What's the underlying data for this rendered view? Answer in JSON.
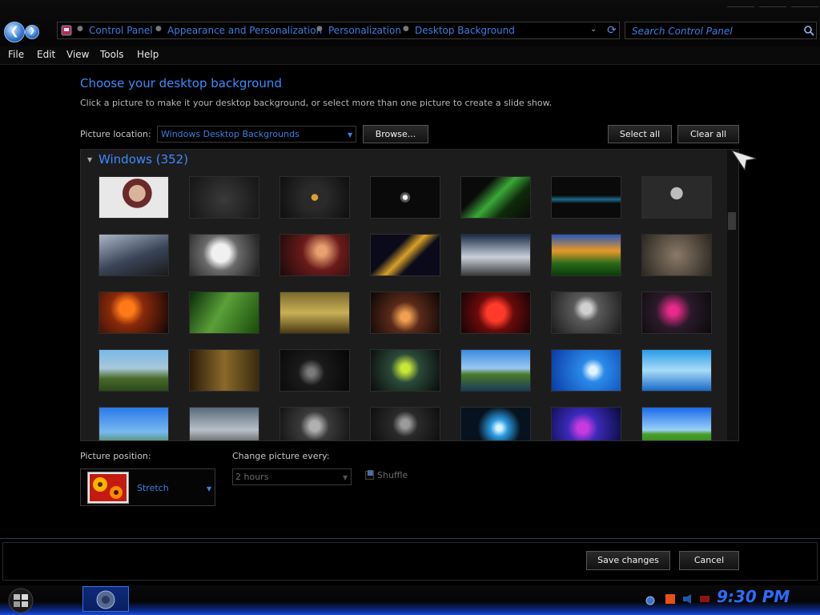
{
  "titlebar": {
    "breadcrumbs": [
      "Control Panel",
      "Appearance and Personalization",
      "Personalization",
      "Desktop Background"
    ],
    "search_placeholder": "Search Control Panel"
  },
  "menu": [
    "File",
    "Edit",
    "View",
    "Tools",
    "Help"
  ],
  "page": {
    "heading": "Choose your desktop background",
    "subtext": "Click a picture to make it your desktop background, or select more than one picture to create a slide show.",
    "picture_location_label": "Picture location:",
    "picture_location_value": "Windows Desktop Backgrounds",
    "browse_label": "Browse...",
    "select_all_label": "Select all",
    "clear_all_label": "Clear all",
    "group_title": "Windows (352)",
    "picture_position_label": "Picture position:",
    "picture_position_value": "Stretch",
    "change_every_label": "Change picture every:",
    "change_every_value": "2 hours",
    "shuffle_label": "Shuffle",
    "shuffle_checked": true
  },
  "footer": {
    "save_label": "Save changes",
    "cancel_label": "Cancel"
  },
  "taskbar": {
    "clock": "9:30 PM"
  },
  "thumbnails": [
    [
      "portrait-woman",
      "dark-gray",
      "windows-logo",
      "round-emblem",
      "green-neon-seven",
      "blue-wave",
      "skull-blue"
    ],
    [
      "spaceship",
      "winged-figure",
      "red-fantasy",
      "gold-sparks",
      "cottage-sky",
      "field-sunset",
      "gray-smoke"
    ],
    [
      "fire-woman",
      "green-grass",
      "golden-forest",
      "orange-glow",
      "red-apple",
      "stage-figure",
      "flower-pink"
    ],
    [
      "cliff-sea",
      "rustic-room",
      "dark-swirl",
      "green-splash",
      "floating-island",
      "blue-bubbles",
      "blue-splash"
    ],
    [
      "blue-sky-tree",
      "gray-clouds",
      "monochrome-figure",
      "dark-portrait",
      "blue-burst",
      "purple-butterfly",
      "house-meadow"
    ]
  ],
  "colors": {
    "accent": "#3d8bff",
    "link": "#3d7fe0",
    "background": "#000000",
    "panel": "#1c1c1c"
  }
}
